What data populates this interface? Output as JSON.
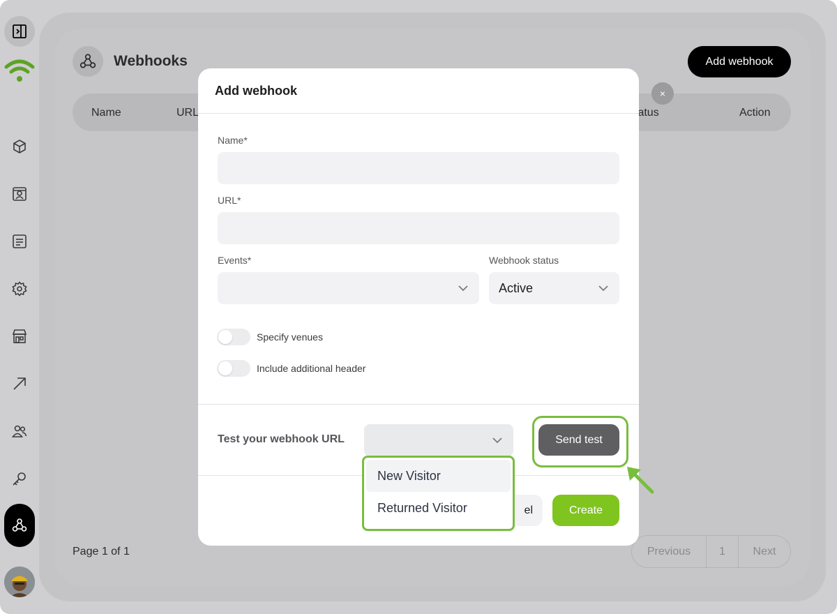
{
  "page": {
    "title": "Webhooks",
    "add_button_label": "Add webhook"
  },
  "table": {
    "columns": [
      "Name",
      "URL",
      "Status",
      "Action"
    ],
    "column_fragments": {
      "url": "URL",
      "status": "tatus"
    }
  },
  "pagination": {
    "info": "Page 1 of 1",
    "previous_label": "Previous",
    "current_page": "1",
    "next_label": "Next"
  },
  "modal": {
    "title": "Add webhook",
    "close_symbol": "×",
    "fields": {
      "name_label": "Name*",
      "name_value": "",
      "url_label": "URL*",
      "url_value": "",
      "events_label": "Events*",
      "events_value": "",
      "status_label": "Webhook status",
      "status_value": "Active"
    },
    "toggles": [
      {
        "label": "Specify venues",
        "on": false
      },
      {
        "label": "Include additional header",
        "on": false
      }
    ],
    "test": {
      "label": "Test your webhook URL",
      "selected_value": "",
      "send_label": "Send test",
      "options": [
        "New Visitor",
        "Returned Visitor"
      ]
    },
    "cancel_label": "Cancel",
    "cancel_visible_fragment": "el",
    "create_label": "Create"
  },
  "colors": {
    "accent_green": "#80c41f",
    "highlight_green": "#79bd3f",
    "logo_green": "#5ca324"
  },
  "icons": {
    "sidebar": [
      "panel-toggle-icon",
      "wifi-logo-icon",
      "box-icon",
      "contact-card-icon",
      "list-icon",
      "gear-icon",
      "store-icon",
      "arrow-up-right-icon",
      "users-icon",
      "key-icon",
      "webhook-icon"
    ]
  }
}
